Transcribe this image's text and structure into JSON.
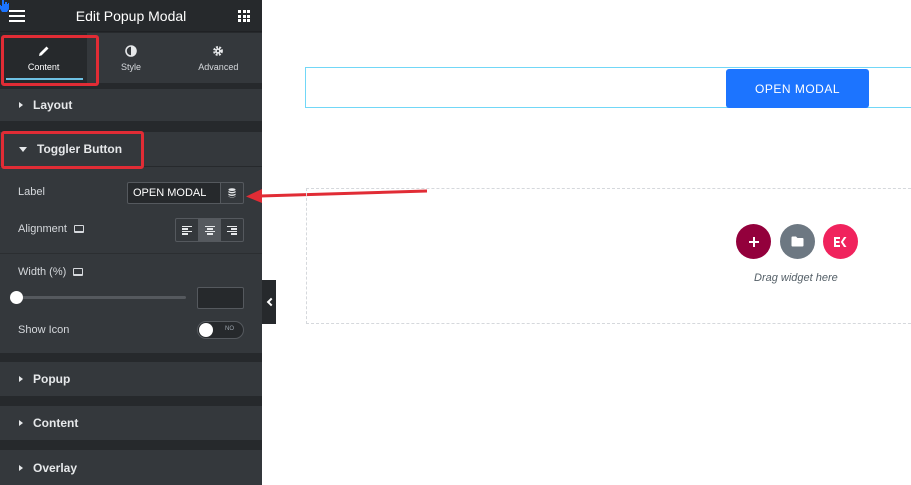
{
  "header": {
    "title": "Edit Popup Modal",
    "menu_icon": "hamburger-icon",
    "widgets_icon": "grid-icon"
  },
  "tabs": [
    {
      "label": "Content",
      "icon": "pencil-icon",
      "active": true
    },
    {
      "label": "Style",
      "icon": "contrast-icon",
      "active": false
    },
    {
      "label": "Advanced",
      "icon": "gear-icon",
      "active": false
    }
  ],
  "sections": {
    "layout": "Layout",
    "toggler": "Toggler Button",
    "popup": "Popup",
    "content": "Content",
    "overlay": "Overlay"
  },
  "controls": {
    "label_label": "Label",
    "label_value": "OPEN MODAL",
    "alignment_label": "Alignment",
    "alignment_options": [
      "left",
      "center",
      "right"
    ],
    "alignment_selected": "center",
    "width_label": "Width (%)",
    "width_value": "",
    "show_icon_label": "Show Icon",
    "show_icon_state": "NO"
  },
  "canvas": {
    "button_label": "OPEN MODAL",
    "drag_text": "Drag widget here"
  },
  "colors": {
    "panel_bg": "#26292c",
    "accent_blue": "#1c74ff",
    "highlight_red": "#e12c35",
    "add_circle": "#93003c",
    "folder_circle": "#6d7882",
    "elementskit_circle": "#f0235d"
  }
}
